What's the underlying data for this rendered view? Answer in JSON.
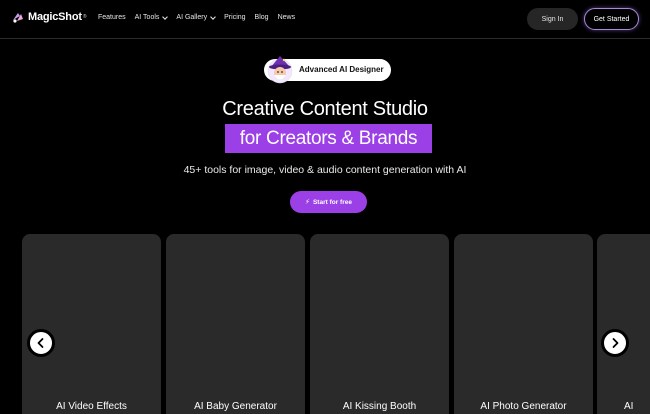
{
  "brand": {
    "name": "MagicShot",
    "reg": "®"
  },
  "nav": {
    "items": [
      {
        "label": "Features",
        "dropdown": false
      },
      {
        "label": "AI Tools",
        "dropdown": true
      },
      {
        "label": "AI Gallery",
        "dropdown": true
      },
      {
        "label": "Pricing",
        "dropdown": false
      },
      {
        "label": "Blog",
        "dropdown": false
      },
      {
        "label": "News",
        "dropdown": false
      }
    ],
    "signin": "Sign In",
    "get_started": "Get Started"
  },
  "hero": {
    "badge": "Advanced AI Designer",
    "title": "Creative Content Studio",
    "highlight": "for Creators & Brands",
    "subtitle": "45+ tools for image, video & audio content generation with AI",
    "cta": "Start for free"
  },
  "carousel": {
    "cards": [
      {
        "label": "AI Video Effects"
      },
      {
        "label": "AI Baby Generator"
      },
      {
        "label": "AI Kissing Booth"
      },
      {
        "label": "AI Photo Generator"
      },
      {
        "label": "AI"
      }
    ]
  },
  "colors": {
    "accent": "#9b3fe6",
    "background": "#000000",
    "card": "#2a2a2a"
  }
}
